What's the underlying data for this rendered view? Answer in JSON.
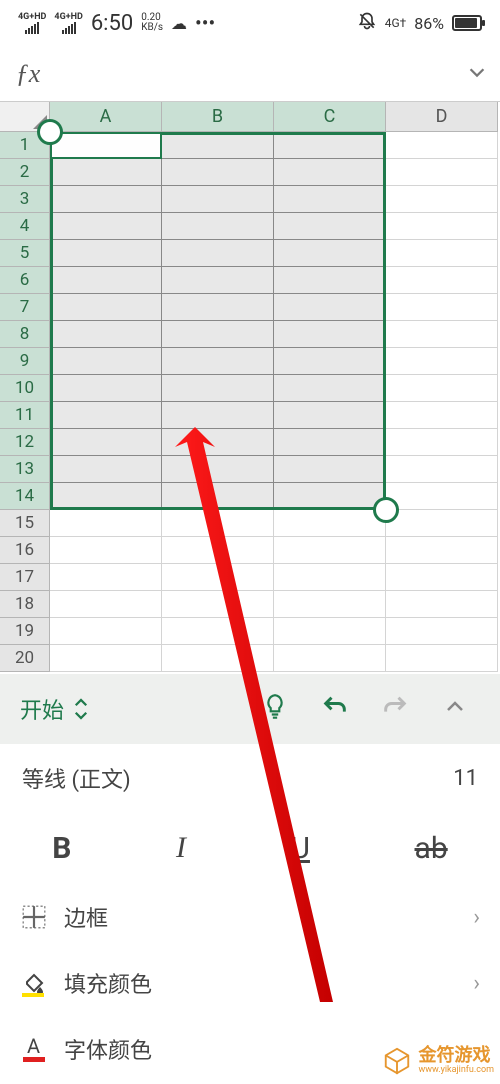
{
  "status": {
    "signal1_top": "4G+HD",
    "signal2_top": "4G+HD",
    "time": "6:50",
    "speed_top": "0.20",
    "speed_bot": "KB/s",
    "net_right": "4G†",
    "battery_pct": "86%"
  },
  "formula": {
    "value": ""
  },
  "columns": [
    "A",
    "B",
    "C",
    "D"
  ],
  "rows": [
    "1",
    "2",
    "3",
    "4",
    "5",
    "6",
    "7",
    "8",
    "9",
    "10",
    "11",
    "12",
    "13",
    "14",
    "15",
    "16",
    "17",
    "18",
    "19",
    "20"
  ],
  "selected_cols": 3,
  "selected_rows": 14,
  "tabbar": {
    "start": "开始"
  },
  "fontbar": {
    "font": "等线 (正文)",
    "size": "11"
  },
  "format": {
    "bold": "B",
    "italic": "I",
    "underline": "U",
    "strike": "ab"
  },
  "options": {
    "border": "边框",
    "fill": "填充颜色",
    "font_color": "字体颜色"
  },
  "watermark": {
    "name": "金符游戏",
    "url": "www.yikajinfu.com"
  },
  "chevron": "›"
}
